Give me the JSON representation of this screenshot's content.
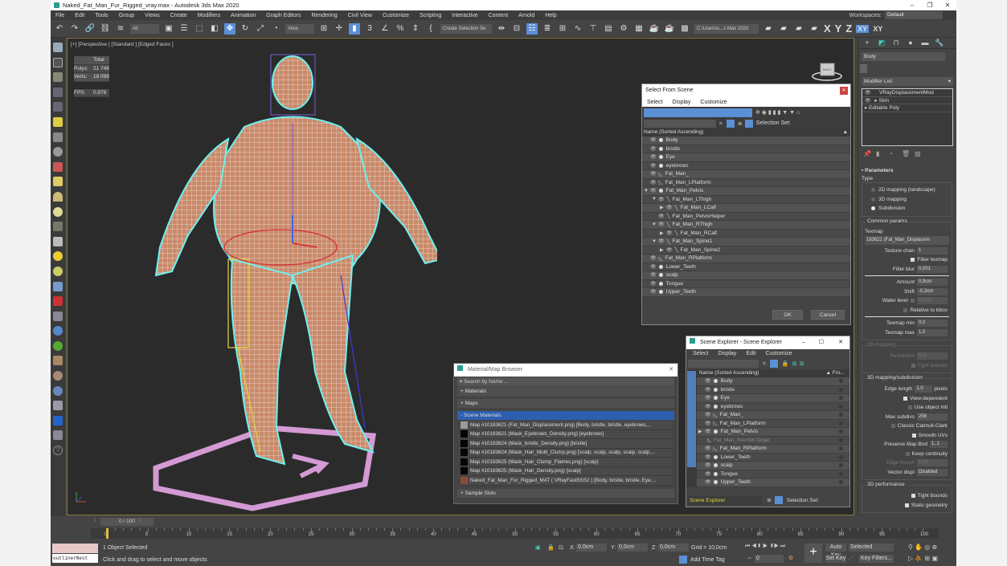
{
  "window": {
    "title": "Naked_Fat_Man_Fur_Rigged_vray.max - Autodesk 3ds Max 2020",
    "controls": [
      "–",
      "❐",
      "✕"
    ]
  },
  "menu": [
    "File",
    "Edit",
    "Tools",
    "Group",
    "Views",
    "Create",
    "Modifiers",
    "Animation",
    "Graph Editors",
    "Rendering",
    "Civil View",
    "Customize",
    "Scripting",
    "Interactive",
    "Content",
    "Arnold",
    "Help"
  ],
  "workspaces": {
    "label": "Workspaces:",
    "value": "Default"
  },
  "toolbar": {
    "selection_filter": "All",
    "ref_coord": "View",
    "named_selection": "Create Selection Se",
    "project_path": "C:\\Users\\u...s Max 2020",
    "axes": [
      "X",
      "Y",
      "Z",
      "XY",
      "XY"
    ]
  },
  "viewport": {
    "label": "[+] [Perspective ] [Standard ] [Edged Faces ]",
    "stats": {
      "header": "Total",
      "polys_label": "Polys:",
      "polys": "21 748",
      "verts_label": "Verts:",
      "verts": "18 099",
      "fps_label": "FPS:",
      "fps": "0,978"
    },
    "viewcube_label": "BACK"
  },
  "command_panel": {
    "object_name": "Body",
    "modifier_list": "Modifier List",
    "stack": [
      "VRayDisplacementMod",
      "Skin",
      "Editable Poly"
    ],
    "params_header": "Parameters",
    "type_label": "Type",
    "type_options": [
      {
        "label": "2D mapping (landscape)",
        "selected": false
      },
      {
        "label": "3D mapping",
        "selected": false
      },
      {
        "label": "Subdivision",
        "selected": true
      }
    ],
    "common_params": "Common params",
    "texmap_label": "Texmap",
    "texmap_value": "183621 (Fat_Man_Displacem",
    "texture_chan_label": "Texture chan",
    "texture_chan": "1",
    "filter_texmap": "Filter texmap",
    "filter_blur_label": "Filter blur",
    "filter_blur": "0,001",
    "amount_label": "Amount",
    "amount": "0,9cm",
    "shift_label": "Shift",
    "shift": "-0,3cm",
    "water_level_label": "Water level",
    "water_level": "0,0cm",
    "relative_bbox": "Relative to bbox",
    "texmap_min_label": "Texmap min",
    "texmap_min": "0,0",
    "texmap_max_label": "Texmap max",
    "texmap_max": "1,0",
    "mapping2d_label": "2D mapping",
    "resolution_label": "Resolution",
    "resolution": "512",
    "tight_bounds_2d": "Tight bounds",
    "subdiv_label": "3D mapping/subdivision",
    "edge_length_label": "Edge length",
    "edge_length": "1,0",
    "edge_unit": "pixels",
    "view_dependent": "View-dependent",
    "use_object_mtl": "Use object mtl",
    "max_subdivs_label": "Max subdivs",
    "max_subdivs": "256",
    "classic_cc": "Classic Catmull-Clark",
    "smooth_uvs": "Smooth UVs",
    "preserve_map_label": "Preserve Map Bnd",
    "preserve_map": "1..1",
    "keep_continuity": "Keep continuity",
    "edge_thresh_label": "Edge thresh",
    "edge_thresh": "0,05",
    "vector_displ_label": "Vector displ",
    "vector_displ": "Disabled",
    "perf_label": "3D performance",
    "tight_bounds": "Tight bounds",
    "static_geometry": "Static geometry"
  },
  "select_from_scene": {
    "title": "Select From Scene",
    "menu": [
      "Select",
      "Display",
      "Customize"
    ],
    "selection_set_label": "Selection Set:",
    "column": "Name (Sorted Ascending)",
    "items": [
      {
        "name": "Body",
        "kind": "geo",
        "depth": 0,
        "expand": ""
      },
      {
        "name": "bristle",
        "kind": "geo",
        "depth": 0,
        "expand": ""
      },
      {
        "name": "Eye",
        "kind": "geo",
        "depth": 0,
        "expand": ""
      },
      {
        "name": "eyebrows",
        "kind": "geo",
        "depth": 0,
        "expand": ""
      },
      {
        "name": "Fat_Man_",
        "kind": "shape",
        "depth": 0,
        "expand": ""
      },
      {
        "name": "Fat_Man_LPlatform",
        "kind": "shape",
        "depth": 0,
        "expand": ""
      },
      {
        "name": "Fat_Man_Pelvis",
        "kind": "geo",
        "depth": 0,
        "expand": "open"
      },
      {
        "name": "Fat_Man_LThigh",
        "kind": "bone",
        "depth": 1,
        "expand": "open"
      },
      {
        "name": "Fat_Man_LCalf",
        "kind": "bone",
        "depth": 2,
        "expand": "closed"
      },
      {
        "name": "Fat_Man_PelvisHelper",
        "kind": "bone",
        "depth": 1,
        "expand": ""
      },
      {
        "name": "Fat_Man_RThigh",
        "kind": "bone",
        "depth": 1,
        "expand": "open"
      },
      {
        "name": "Fat_Man_RCalf",
        "kind": "bone",
        "depth": 2,
        "expand": "closed"
      },
      {
        "name": "Fat_Man_Spine1",
        "kind": "bone",
        "depth": 1,
        "expand": "open"
      },
      {
        "name": "Fat_Man_Spine2",
        "kind": "bone",
        "depth": 2,
        "expand": "closed"
      },
      {
        "name": "Fat_Man_RPlatform",
        "kind": "shape",
        "depth": 0,
        "expand": ""
      },
      {
        "name": "Lower_Teeth",
        "kind": "geo",
        "depth": 0,
        "expand": ""
      },
      {
        "name": "scalp",
        "kind": "geo",
        "depth": 0,
        "expand": ""
      },
      {
        "name": "Tongue",
        "kind": "geo",
        "depth": 0,
        "expand": ""
      },
      {
        "name": "Upper_Teeth",
        "kind": "geo",
        "depth": 0,
        "expand": ""
      }
    ],
    "ok": "OK",
    "cancel": "Cancel"
  },
  "scene_explorer": {
    "title": "Scene Explorer - Scene Explorer",
    "menu": [
      "Select",
      "Display",
      "Edit",
      "Customize"
    ],
    "column": "Name (Sorted Ascending)",
    "column2": "▲ Fro...",
    "items": [
      {
        "name": "Body",
        "kind": "geo",
        "dim": false,
        "expand": ""
      },
      {
        "name": "bristle",
        "kind": "geo",
        "dim": false,
        "expand": ""
      },
      {
        "name": "Eye",
        "kind": "geo",
        "dim": false,
        "expand": ""
      },
      {
        "name": "eyebrows",
        "kind": "geo",
        "dim": false,
        "expand": ""
      },
      {
        "name": "Fat_Man_",
        "kind": "shape",
        "dim": false,
        "expand": ""
      },
      {
        "name": "Fat_Man_LPlatform",
        "kind": "shape",
        "dim": false,
        "expand": ""
      },
      {
        "name": "Fat_Man_Pelvis",
        "kind": "geo",
        "dim": false,
        "expand": "closed"
      },
      {
        "name": "Fat_Man_RArmIKTarget",
        "kind": "shape",
        "dim": true,
        "expand": ""
      },
      {
        "name": "Fat_Man_RPlatform",
        "kind": "shape",
        "dim": false,
        "expand": ""
      },
      {
        "name": "Lower_Teeth",
        "kind": "geo",
        "dim": false,
        "expand": ""
      },
      {
        "name": "scalp",
        "kind": "geo",
        "dim": false,
        "expand": ""
      },
      {
        "name": "Tongue",
        "kind": "geo",
        "dim": false,
        "expand": ""
      },
      {
        "name": "Upper_Teeth",
        "kind": "geo",
        "dim": false,
        "expand": ""
      }
    ],
    "footer_dropdown": "Scene Explorer",
    "selection_set_label": "Selection Set:"
  },
  "material_browser": {
    "title": "Material/Map Browser",
    "search_placeholder": "Search by Name ...",
    "sections": [
      "+ Materials",
      "+ Maps",
      "- Scene Materials",
      "+ Sample Slots"
    ],
    "items": [
      {
        "label": "Map #10183621 (Fat_Man_Displacement.png) [Body, bristle, bristle, eyebrows,...",
        "swatch": "#9a9a9a"
      },
      {
        "label": "Map #10183621 (Mask_Eyebrows_Density.png) [eyebrows]",
        "swatch": "#050505"
      },
      {
        "label": "Map #10183624 (Mask_bristle_Density.png) [bristle]",
        "swatch": "#050505"
      },
      {
        "label": "Map #10183624 (Mask_Hair_Multi_Clump.png) [scalp, scalp, scalp, scalp, scalp,...",
        "swatch": "#050505"
      },
      {
        "label": "Map #10183625 (Mask_Hair_Clump_Flatnes.png) [scalp]",
        "swatch": "#050505"
      },
      {
        "label": "Map #10183625 (Mask_Hair_Density.png) [scalp]",
        "swatch": "#050505"
      },
      {
        "label": "Naked_Fat_Man_Fur_Rigged_MAT ( VRayFastSSS2 ) [Body, bristle, bristle, Eye,...",
        "swatch": "#8a4a3a"
      }
    ]
  },
  "timeline": {
    "frame_display": "0 / 100",
    "ticks": [
      "0",
      "5",
      "10",
      "15",
      "20",
      "25",
      "30",
      "35",
      "40",
      "45",
      "50",
      "55",
      "60",
      "65",
      "70",
      "75",
      "80",
      "85",
      "90",
      "95",
      "100"
    ]
  },
  "status": {
    "script_listener": "outlinerNest",
    "selected": "1 Object Selected",
    "prompt": "Click and drag to select and move objects",
    "x_label": "X:",
    "x": "0,0cm",
    "y_label": "Y:",
    "y": "0,0cm",
    "z_label": "Z:",
    "z": "0,0cm",
    "grid": "Grid = 10,0cm",
    "add_time_tag": "Add Time Tag",
    "current_frame": "0",
    "auto_key": "Auto Key",
    "set_key": "Set Key",
    "key_mode": "Selected",
    "key_filters": "Key Filters..."
  },
  "colors": {
    "accent": "#5b8fd6",
    "selection_blue": "#2d5fb0",
    "viewport_bg": "#2b2b2b",
    "stats_text": "#e0d640",
    "skin": "#c98a6a",
    "outline": "#6ff0f0",
    "platform": "#d49ad4"
  }
}
